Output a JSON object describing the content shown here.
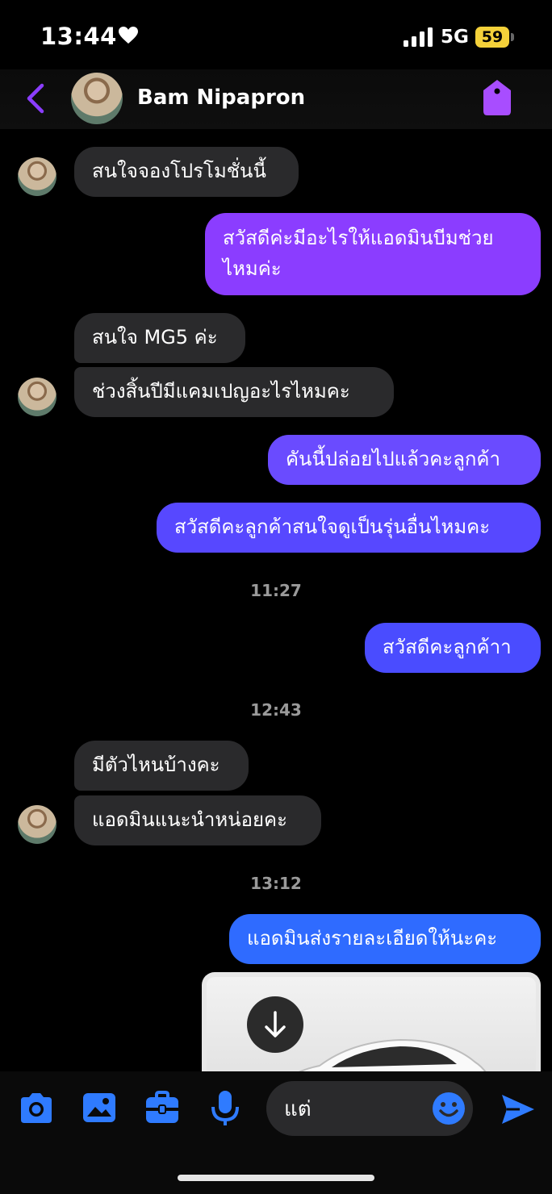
{
  "status_bar": {
    "time": "13:44",
    "network": "5G",
    "battery": "59"
  },
  "header": {
    "contact_name": "Bam Nipapron",
    "back_icon": "chevron-left-icon",
    "tag_icon": "tag-icon"
  },
  "messages": [
    {
      "dir": "in",
      "text": "สนใจจองโปรโมชั่นนี้"
    },
    {
      "dir": "out",
      "text": "สวัสดีค่ะมีอะไรให้แอดมินบีมช่วย",
      "text2": "ไหมค่ะ"
    },
    {
      "dir": "in",
      "text": "สนใจ MG5 ค่ะ"
    },
    {
      "dir": "in",
      "text": "ช่วงสิ้นปีมีแคมเปญอะไรไหมคะ"
    },
    {
      "dir": "out",
      "text": "คันนี้ปล่อยไปแล้วคะลูกค้า"
    },
    {
      "dir": "out",
      "text": "สวัสดีคะลูกค้าสนใจดูเป็นรุ่นอื่นไหมคะ"
    },
    {
      "dir": "ts",
      "text": "11:27"
    },
    {
      "dir": "out",
      "text": "สวัสดีคะลูกค้าา"
    },
    {
      "dir": "ts",
      "text": "12:43"
    },
    {
      "dir": "in",
      "text": "มีตัวไหนบ้างคะ"
    },
    {
      "dir": "in",
      "text": "แอดมินแนะนำหน่อยคะ"
    },
    {
      "dir": "ts",
      "text": "13:12"
    },
    {
      "dir": "out",
      "text": "แอดมินส่งรายละเอียดให้นะคะ"
    }
  ],
  "input": {
    "value": "แต่"
  },
  "colors": {
    "accent": "#8b3dff",
    "bubble_out_top": "#8b3dff",
    "bubble_out_bottom": "#2f6bff",
    "bubble_in": "#2a2a2c"
  }
}
